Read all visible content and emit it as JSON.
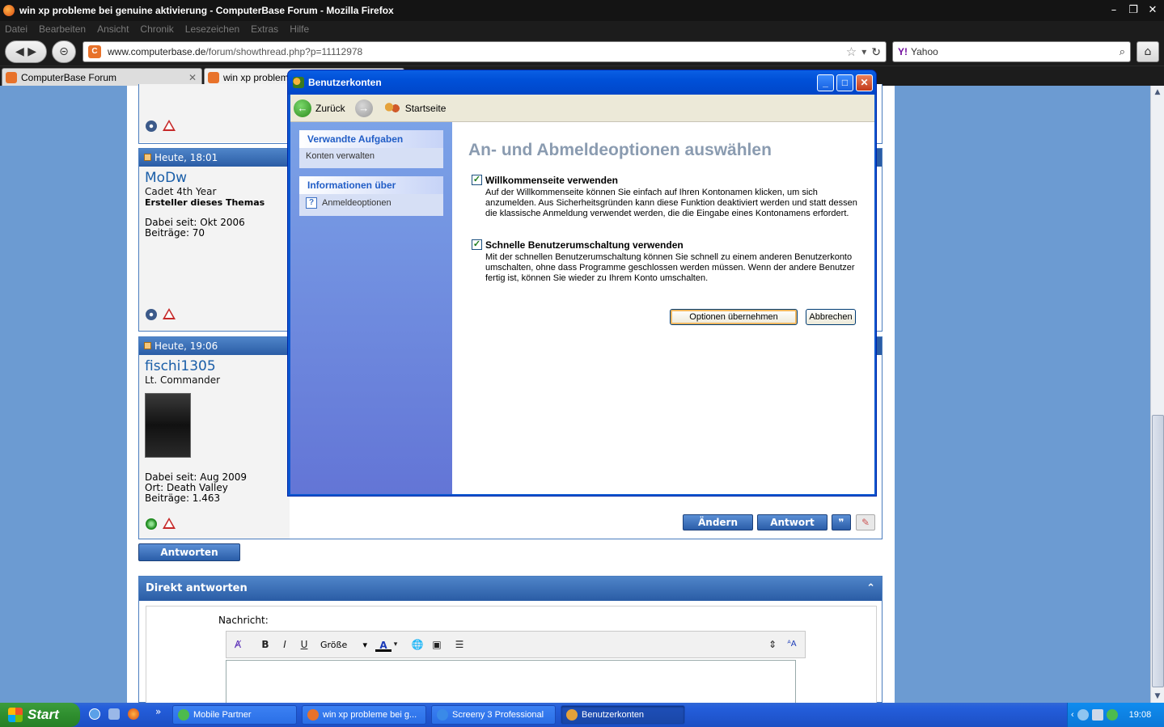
{
  "browser": {
    "title": "win xp probleme bei genuine aktivierung - ComputerBase Forum - Mozilla Firefox",
    "menu": [
      "Datei",
      "Bearbeiten",
      "Ansicht",
      "Chronik",
      "Lesezeichen",
      "Extras",
      "Hilfe"
    ],
    "url_host": "www.computerbase.de",
    "url_path": "/forum/showthread.php?p=11112978",
    "search_engine": "Yahoo",
    "tabs": [
      {
        "label": "ComputerBase Forum"
      },
      {
        "label": "win xp probleme"
      }
    ]
  },
  "posts": [
    {
      "time": "Heute, 18:01",
      "user": "MoDw",
      "rank": "Cadet 4th Year",
      "badge": "Ersteller dieses Themas",
      "since": "Dabei seit: Okt 2006",
      "posts": "Beiträge: 70"
    },
    {
      "time": "Heute, 19:06",
      "user": "fischi1305",
      "rank": "Lt. Commander",
      "since": "Dabei seit: Aug 2009",
      "location": "Ort: Death Valley",
      "posts": "Beiträge: 1.463"
    }
  ],
  "post_buttons": {
    "edit": "Ändern",
    "reply": "Antwort"
  },
  "reply_button": "Antworten",
  "quick_reply": {
    "title": "Direkt antworten",
    "message_label": "Nachricht:",
    "size_label": "Größe"
  },
  "dialog": {
    "title": "Benutzerkonten",
    "back": "Zurück",
    "home": "Startseite",
    "related_title": "Verwandte Aufgaben",
    "related_items": [
      "Konten verwalten"
    ],
    "info_title": "Informationen über",
    "info_items": [
      "Anmeldeoptionen"
    ],
    "heading": "An- und Abmeldeoptionen auswählen",
    "option1_label": "Willkommenseite verwenden",
    "option1_desc": "Auf der Willkommenseite können Sie einfach auf Ihren Kontonamen klicken, um sich anzumelden. Aus Sicherheitsgründen kann diese Funktion deaktiviert werden und statt dessen die klassische Anmeldung verwendet werden, die die Eingabe eines Kontonamens erfordert.",
    "option1_checked": true,
    "option2_label": "Schnelle Benutzerumschaltung verwenden",
    "option2_desc": "Mit der schnellen Benutzerumschaltung können Sie schnell zu einem anderen Benutzerkonto umschalten, ohne dass Programme geschlossen werden müssen. Wenn der andere Benutzer fertig ist, können Sie wieder zu Ihrem Konto umschalten.",
    "option2_checked": true,
    "apply": "Optionen übernehmen",
    "cancel": "Abbrechen"
  },
  "taskbar": {
    "start": "Start",
    "items": [
      "Mobile Partner",
      "win xp probleme bei g...",
      "Screeny 3 Professional",
      "Benutzerkonten"
    ],
    "clock": "19:08"
  }
}
